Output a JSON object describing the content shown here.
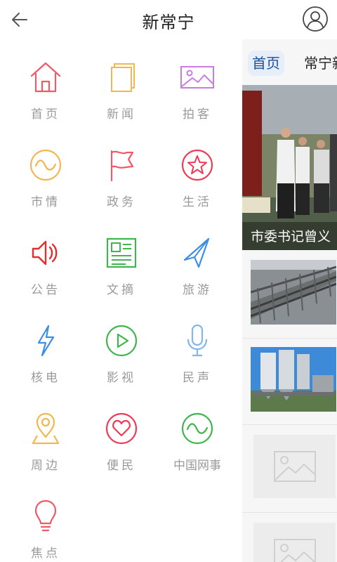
{
  "header": {
    "title": "新常宁",
    "icons": {
      "back": "arrow-left-icon",
      "profile": "user-avatar-icon"
    }
  },
  "drawer": {
    "items": [
      {
        "label": "首页",
        "icon": "home-icon",
        "color": "#ef5a68"
      },
      {
        "label": "新闻",
        "icon": "news-pages-icon",
        "color": "#f4b64f"
      },
      {
        "label": "拍客",
        "icon": "image-icon",
        "color": "#c77ce0"
      },
      {
        "label": "市情",
        "icon": "wave-circle-icon",
        "color": "#f4b64f"
      },
      {
        "label": "政务",
        "icon": "flag-icon",
        "color": "#ef5a68"
      },
      {
        "label": "生活",
        "icon": "star-circle-icon",
        "color": "#ef3a57"
      },
      {
        "label": "公告",
        "icon": "speaker-icon",
        "color": "#e52d2d"
      },
      {
        "label": "文摘",
        "icon": "newspaper-icon",
        "color": "#3fb64b"
      },
      {
        "label": "旅游",
        "icon": "paper-plane-icon",
        "color": "#3d8fe3"
      },
      {
        "label": "核电",
        "icon": "lightning-icon",
        "color": "#3d8fe3"
      },
      {
        "label": "影视",
        "icon": "play-circle-icon",
        "color": "#3fb64b"
      },
      {
        "label": "民声",
        "icon": "microphone-icon",
        "color": "#7fb7ee"
      },
      {
        "label": "周边",
        "icon": "map-pin-icon",
        "color": "#f4b64f"
      },
      {
        "label": "便民",
        "icon": "heart-circle-icon",
        "color": "#ef3a57"
      },
      {
        "label": "中国网事",
        "icon": "wave-circle-icon",
        "color": "#3fb64b"
      },
      {
        "label": "焦点",
        "icon": "lightbulb-icon",
        "color": "#ef5a68"
      }
    ]
  },
  "content": {
    "tabs": [
      "首页",
      "常宁新闻"
    ],
    "hero_caption": "市委书记曾义",
    "news": [
      {
        "thumb": "railway-track-photo"
      },
      {
        "thumb": "concrete-silo-photo"
      },
      {
        "thumb": "image-placeholder"
      },
      {
        "thumb": "image-placeholder"
      }
    ]
  },
  "colors": {
    "accent": "#1a4f9a",
    "tab_bg": "#e6eef9",
    "muted_text": "#9a9a9a"
  }
}
